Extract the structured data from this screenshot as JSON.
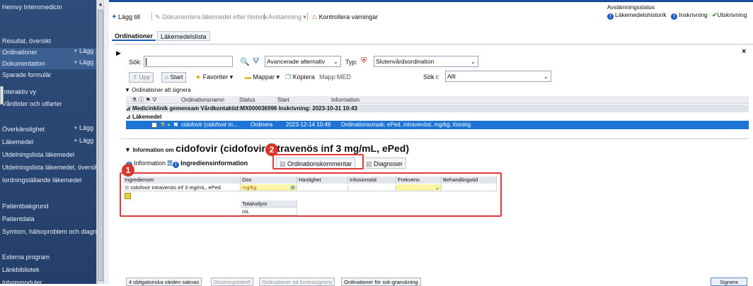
{
  "sidebar": {
    "title": "Hemvy Internmedicin",
    "items": [
      {
        "label": "Resultat, översikt",
        "add": ""
      },
      {
        "label": "Ordinationer",
        "add": "+ Lägg"
      },
      {
        "label": "Dokumentation",
        "add": "+ Lägg"
      },
      {
        "label": "Sparade formulär",
        "add": ""
      },
      {
        "label": "Interaktiv vy",
        "add": ""
      },
      {
        "label": "Vårdtider och utfarter",
        "add": ""
      },
      {
        "label": "Överkänslighet",
        "add": "+ Lägg"
      },
      {
        "label": "Läkemedel",
        "add": "+ Lägg"
      },
      {
        "label": "Utdelningslista läkemedel",
        "add": ""
      },
      {
        "label": "Utdelningslista läkemedel, översikt",
        "add": ""
      },
      {
        "label": "Iordningställande läkemedel",
        "add": ""
      },
      {
        "label": "Patientbakgrund",
        "add": ""
      },
      {
        "label": "Patientdata",
        "add": ""
      },
      {
        "label": "Symtom, hälsoproblem och diagn",
        "add": ""
      },
      {
        "label": "Externa program",
        "add": ""
      },
      {
        "label": "Länkbibliotek",
        "add": ""
      },
      {
        "label": "Intygsmoduler",
        "add": ""
      }
    ]
  },
  "toolbar": {
    "add": "Lägg till",
    "document": "Dokumentera läkemedel efter historik",
    "reconcile": "Avstämning",
    "check": "Kontrollera varningar"
  },
  "status": {
    "title": "Avstämningsstatus",
    "items": [
      "Läkemedelshistorik",
      "Inskrivning",
      "Utskrivning"
    ]
  },
  "tabs": [
    "Ordinationer",
    "Läkemedelslista"
  ],
  "search": {
    "label": "Sök:",
    "value": "",
    "advanced": "Avancerade alternativ",
    "type_label": "Typ:",
    "type_value": "Slutenvårdsordination",
    "search_in_label": "Sök i:",
    "search_in_value": "Allt"
  },
  "nav": {
    "up": "Upp",
    "start": "Start",
    "favorites": "Favoriter",
    "folders": "Mappar",
    "copy": "Kopiera",
    "folder": "Mapp:MED"
  },
  "list": {
    "section": "Ordinationer att signera",
    "columns": [
      "Ordinationsnamn",
      "Status",
      "Start",
      "Information"
    ],
    "group1": "Medicinklinik gemensam  Vårdkontaktid:MX000036996  Inskrivning: 2023-10-31 10:43",
    "group2": "Läkemedel",
    "row": {
      "name": "cidofovir (cidofovir in...",
      "status": "Ordinera",
      "start": "2023-12-14 10:49",
      "info": "Ordinationsorsak: ePed, intravenöst, mg/kg, lösning"
    }
  },
  "info": {
    "prefix": "Information om",
    "title": "cidofovir (cidofovir intravenös inf 3 mg/mL, ePed)",
    "tabs": [
      "Information",
      "Ingrediensinformation",
      "Ordinationskommentar",
      "Diagnoser"
    ]
  },
  "ingredients": {
    "headers": [
      "Ingredienser",
      "Dos",
      "Hastighet",
      "Infusionstid",
      "Frekvens",
      "Behandlingstid"
    ],
    "name": "cidofovir intravenös inf 3 mg/mL, ePed",
    "dose_unit": "mg/kg",
    "total_label": "Totalvolym",
    "total_unit": "mL"
  },
  "annotations": [
    "1",
    "2"
  ],
  "bottom": {
    "missing": "4 obligatoriska värden saknas",
    "dose_table": "Doseringstabell",
    "cosign": "Ordinationer att kontrasignera",
    "ssk": "Ordinationer för ssk-granskning",
    "sign": "Signera"
  },
  "colors": {
    "sidebar": "#2f4d7a",
    "selection": "#1d74d6",
    "annotation": "#e03a3a",
    "required": "#fbf6a6"
  }
}
